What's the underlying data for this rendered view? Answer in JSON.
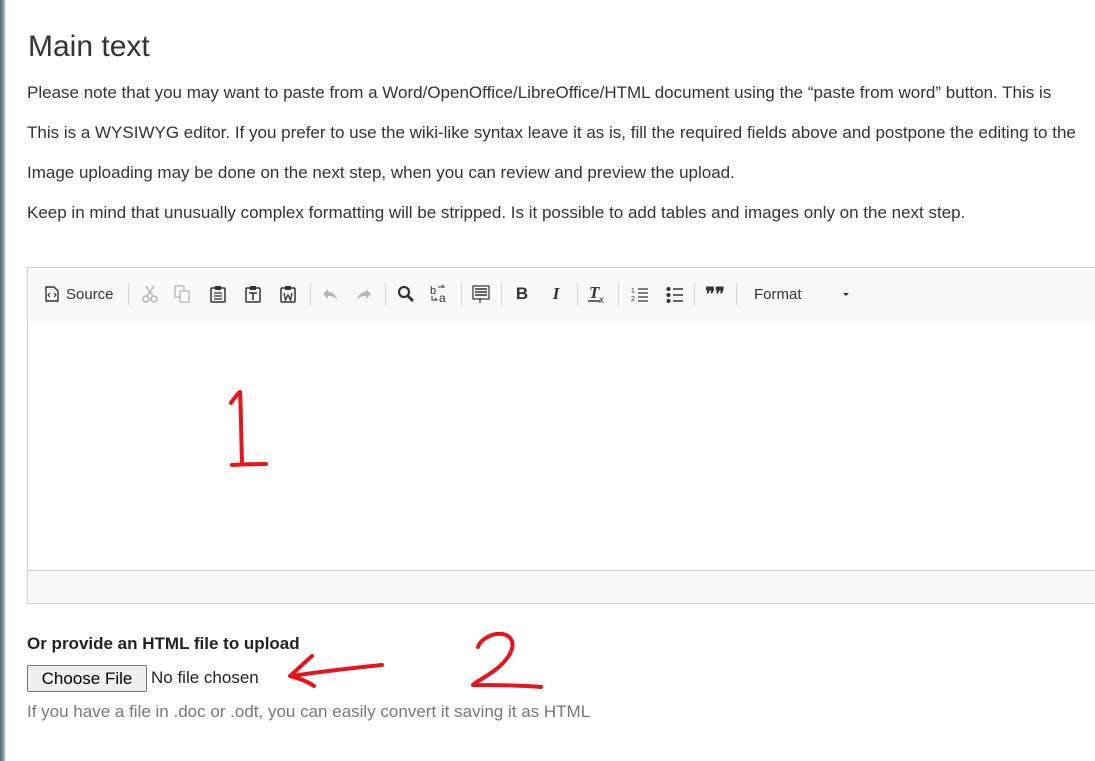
{
  "section_title": "Main text",
  "paragraphs": [
    "Please note that you may want to paste from a Word/OpenOffice/LibreOffice/HTML document using the “paste from word” button. This is",
    "This is a WYSIWYG editor. If you prefer to use the wiki-like syntax leave it as is, fill the required fields above and postpone the editing to the",
    "Image uploading may be done on the next step, when you can review and preview the upload.",
    "Keep in mind that unusually complex formatting will be stripped. Is it possible to add tables and images only on the next step."
  ],
  "editor": {
    "toolbar": {
      "source_label": "Source",
      "format_label": "Format",
      "icons": [
        "source-icon",
        "cut-icon",
        "copy-icon",
        "paste-icon",
        "paste-text-icon",
        "paste-from-word-icon",
        "undo-icon",
        "redo-icon",
        "find-icon",
        "replace-icon",
        "select-all-icon",
        "bold-icon",
        "italic-icon",
        "remove-format-icon",
        "numbered-list-icon",
        "bulleted-list-icon",
        "blockquote-icon"
      ],
      "bold_glyph": "B",
      "italic_glyph": "I",
      "blockquote_glyph": "❞❞"
    }
  },
  "upload": {
    "label": "Or provide an HTML file to upload",
    "button_label": "Choose File",
    "status": "No file chosen",
    "hint": "If you have a file in .doc or .odt, you can easily convert it saving it as HTML"
  },
  "annotations": {
    "mark_1": "1",
    "mark_2": "2",
    "color": "#e8141b"
  },
  "colors": {
    "text": "#333333",
    "hint": "#777777",
    "toolbar_bg": "#f8f8f8",
    "border": "#d1d1d1"
  }
}
